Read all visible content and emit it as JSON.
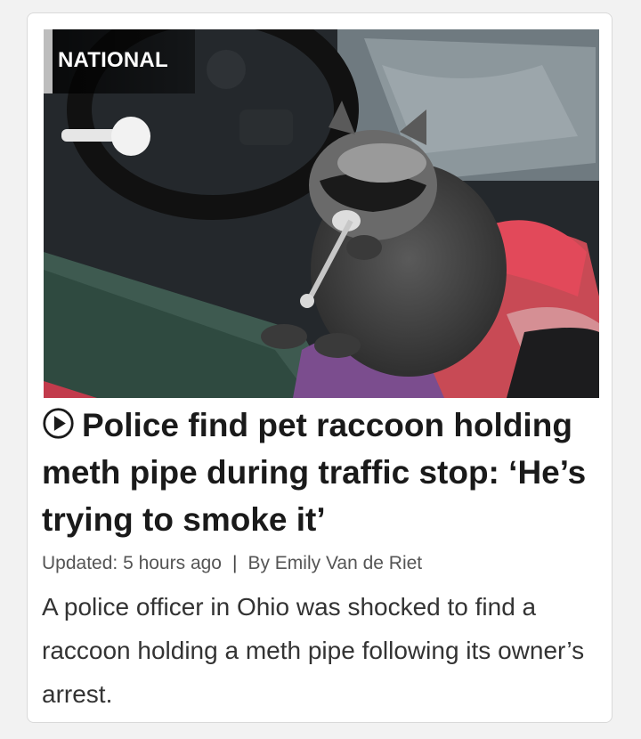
{
  "article": {
    "category": "NATIONAL",
    "media_type": "video",
    "headline": "Police find pet raccoon holding meth pipe during traffic stop: ‘He’s trying to smoke it’",
    "updated_label": "Updated: 5 hours ago",
    "separator": "|",
    "byline": "By Emily Van de Riet",
    "summary": "A police officer in Ohio was shocked to find a raccoon holding a meth pipe following its owner’s arrest."
  },
  "icons": {
    "play": "play-circle-icon"
  },
  "colors": {
    "headline": "#1a1a1a",
    "meta": "#555555",
    "summary": "#333333",
    "badge_bar": "#bdbdbd"
  }
}
